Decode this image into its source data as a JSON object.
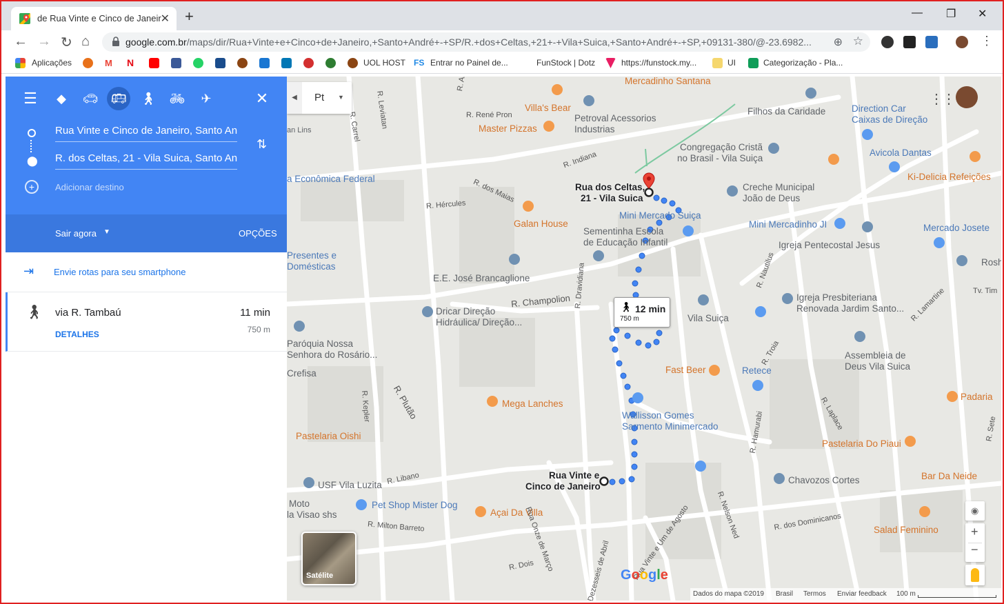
{
  "browser": {
    "tab_title": "de Rua Vinte e Cinco de Janeiro a",
    "url_host": "google.com.br",
    "url_path": "/maps/dir/Rua+Vinte+e+Cinco+de+Janeiro,+Santo+André+-+SP/R.+dos+Celtas,+21+-+Vila+Suica,+Santo+André+-+SP,+09131-380/@-23.6982...",
    "bookmarks": [
      "Aplicações",
      "UOL HOST",
      "Entrar no Painel de...",
      "FunStock | Dotz",
      "https://funstock.my...",
      "UI",
      "Categorização - Pla..."
    ]
  },
  "panel": {
    "origin": "Rua Vinte e Cinco de Janeiro, Santo André",
    "destination": "R. dos Celtas, 21 - Vila Suica, Santo André",
    "add_destination": "Adicionar destino",
    "depart": "Sair agora",
    "options": "OPÇÕES",
    "send_to_phone": "Envie rotas para seu smartphone",
    "route_via": "via R. Tambaú",
    "route_time": "11 min",
    "route_details": "DETALHES",
    "route_distance": "750 m"
  },
  "map": {
    "layer_button": "Pt",
    "route_bubble_time": "12 min",
    "route_bubble_dist": "750 m",
    "dest_label_1": "Rua dos Celtas,",
    "dest_label_2": "21 - Vila Suica",
    "origin_label_1": "Rua Vinte e",
    "origin_label_2": "Cinco de Janeiro",
    "satellite": "Satélite",
    "footer": {
      "data": "Dados do mapa ©2019",
      "country": "Brasil",
      "terms": "Termos",
      "feedback": "Enviar feedback",
      "scale": "100 m"
    },
    "pois": [
      {
        "t": "Mercadinho Santana",
        "c": "orange"
      },
      {
        "t": "Villa's Bear",
        "c": "orange"
      },
      {
        "t": "Master Pizzas",
        "c": "orange"
      },
      {
        "t": "Petroval Acessorios",
        "c": "gray"
      },
      {
        "t": "Industrias",
        "c": "gray"
      },
      {
        "t": "Filhos da Caridade",
        "c": "gray"
      },
      {
        "t": "Direction Car",
        "c": "blue"
      },
      {
        "t": "Caixas de Direção",
        "c": "blue"
      },
      {
        "t": "Congregação Cristã",
        "c": "gray"
      },
      {
        "t": "no Brasil - Vila Suiça",
        "c": "gray"
      },
      {
        "t": "Avicola Dantas",
        "c": "blue"
      },
      {
        "t": "Ki-Delicia Refeições",
        "c": "orange"
      },
      {
        "t": "Creche Municipal",
        "c": "gray"
      },
      {
        "t": "João de Deus",
        "c": "gray"
      },
      {
        "t": "Galan House",
        "c": "orange"
      },
      {
        "t": "Mini Mercado Suiça",
        "c": "blue"
      },
      {
        "t": "Sementinha Escola",
        "c": "gray"
      },
      {
        "t": "de Educação Infantil",
        "c": "gray"
      },
      {
        "t": "Mini Mercadinho JI",
        "c": "blue"
      },
      {
        "t": "Mercado Josete",
        "c": "blue"
      },
      {
        "t": "Igreja Pentecostal Jesus",
        "c": "gray"
      },
      {
        "t": "E.E. José Brancaglione",
        "c": "gray"
      },
      {
        "t": "Rosha",
        "c": "gray"
      },
      {
        "t": "a Econômica Federal",
        "c": "blue"
      },
      {
        "t": "Presentes e",
        "c": "blue"
      },
      {
        "t": "Domésticas",
        "c": "blue"
      },
      {
        "t": "Dricar Direção",
        "c": "gray"
      },
      {
        "t": "Hidráulica/ Direção...",
        "c": "gray"
      },
      {
        "t": "Vila Suiça",
        "c": "gray"
      },
      {
        "t": "Igreja Presbiteriana",
        "c": "gray"
      },
      {
        "t": "Renovada Jardim Santo...",
        "c": "gray"
      },
      {
        "t": "Paróquia Nossa",
        "c": "gray"
      },
      {
        "t": "Senhora do Rosário...",
        "c": "gray"
      },
      {
        "t": "Crefisa",
        "c": "gray"
      },
      {
        "t": "Fast Beer",
        "c": "orange"
      },
      {
        "t": "Retece",
        "c": "blue"
      },
      {
        "t": "Assembleia de",
        "c": "gray"
      },
      {
        "t": "Deus Vila Suica",
        "c": "gray"
      },
      {
        "t": "Mega Lanches",
        "c": "orange"
      },
      {
        "t": "Padaria",
        "c": "orange"
      },
      {
        "t": "Wallisson Gomes",
        "c": "blue"
      },
      {
        "t": "Sarmento Minimercado",
        "c": "blue"
      },
      {
        "t": "Pastelaria Oishi",
        "c": "orange"
      },
      {
        "t": "Pastelaria Do Piaui",
        "c": "orange"
      },
      {
        "t": "USF Vila Luzita",
        "c": "gray"
      },
      {
        "t": "Pet Shop Mister Dog",
        "c": "blue"
      },
      {
        "t": "Chavozos Cortes",
        "c": "gray"
      },
      {
        "t": "Bar Da Neide",
        "c": "orange"
      },
      {
        "t": "Moto",
        "c": "gray"
      },
      {
        "t": "la Visao shs",
        "c": "gray"
      },
      {
        "t": "Açai Da Villa",
        "c": "orange"
      },
      {
        "t": "Salad Feminino",
        "c": "orange"
      },
      {
        "t": "an Lins",
        "c": "gray"
      }
    ],
    "streets": [
      "R. Leviatan",
      "R. Albino de Morais",
      "R. Carrel",
      "R. René Pron",
      "R. Indiana",
      "R. dos Maias",
      "R. Hércules",
      "R. Champolion",
      "R. Plutão",
      "R. Kepler",
      "R. Libano",
      "R. Milton Barreto",
      "R. Dravidiana",
      "R. Nautilus",
      "R. Troia",
      "R. Hamurabi",
      "R. Laplace",
      "R. Nelson Ned",
      "R. Dezesseis de Abril",
      "Rua Vinte e Um de Agosto",
      "R. Dois",
      "Rua Onze de Março",
      "R. dos Dominicanos",
      "R. Lamartine",
      "R. Sete",
      "Tv. Tim"
    ]
  }
}
